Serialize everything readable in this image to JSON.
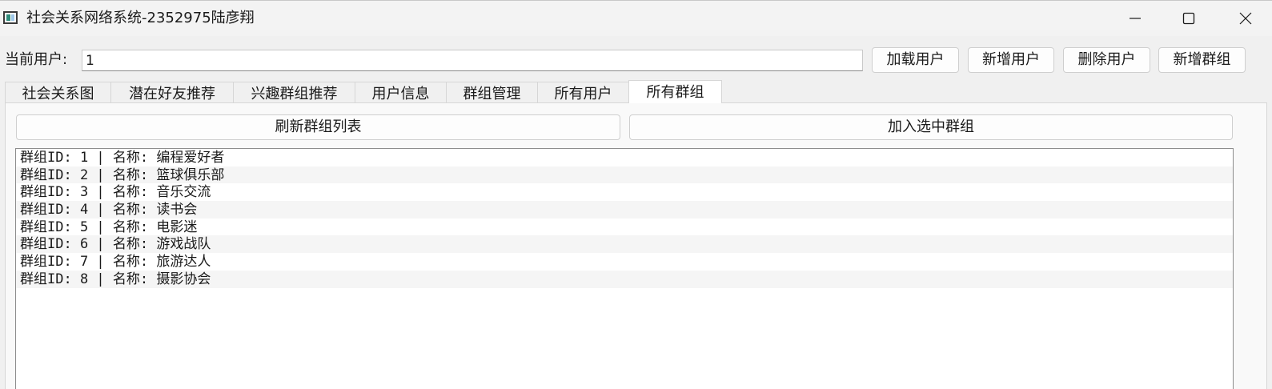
{
  "window": {
    "title": "社会关系网络系统-2352975陆彦翔"
  },
  "toolbar": {
    "current_user_label": "当前用户:",
    "current_user_value": "1",
    "load_user": "加载用户",
    "add_user": "新增用户",
    "delete_user": "删除用户",
    "add_group": "新增群组"
  },
  "tabs": [
    {
      "label": "社会关系图"
    },
    {
      "label": "潜在好友推荐"
    },
    {
      "label": "兴趣群组推荐"
    },
    {
      "label": "用户信息"
    },
    {
      "label": "群组管理"
    },
    {
      "label": "所有用户"
    },
    {
      "label": "所有群组",
      "active": true
    }
  ],
  "groups_page": {
    "refresh_button": "刷新群组列表",
    "join_button": "加入选中群组",
    "groups": [
      "群组ID: 1 | 名称: 编程爱好者",
      "群组ID: 2 | 名称: 篮球俱乐部",
      "群组ID: 3 | 名称: 音乐交流",
      "群组ID: 4 | 名称: 读书会",
      "群组ID: 5 | 名称: 电影迷",
      "群组ID: 6 | 名称: 游戏战队",
      "群组ID: 7 | 名称: 旅游达人",
      "群组ID: 8 | 名称: 摄影协会"
    ]
  },
  "icons": {
    "app": "app-window-icon",
    "minimize": "minimize-icon",
    "maximize": "maximize-icon",
    "close": "close-icon"
  }
}
